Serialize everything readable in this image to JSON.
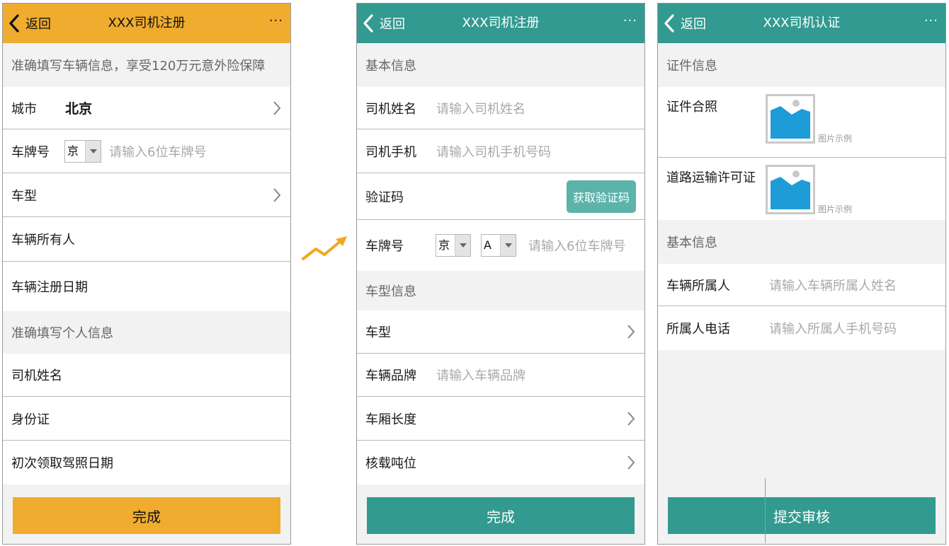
{
  "colors": {
    "orange": "#efac2e",
    "teal": "#329a90",
    "teal_light": "#5bb3aa",
    "section_bg": "#f2f2f2",
    "placeholder": "#a9a9a9",
    "image_blue": "#1e9cd7"
  },
  "icons": {
    "back": "chevron-left-icon",
    "more": "ellipsis-icon",
    "row_arrow": "chevron-right-icon",
    "select_arrow": "caret-down-icon",
    "flow": "trend-arrow-icon",
    "photo": "image-placeholder-icon"
  },
  "screen1": {
    "nav": {
      "back": "返回",
      "title": "XXX司机注册",
      "more": "···"
    },
    "notice": "准确填写车辆信息，享受120万元意外险保障",
    "rows": {
      "city": {
        "label": "城市",
        "value": "北京"
      },
      "plate": {
        "label": "车牌号",
        "province": "京",
        "placeholder": "请输入6位车牌号"
      },
      "model": {
        "label": "车型"
      },
      "owner": {
        "label": "车辆所有人"
      },
      "reg_date": {
        "label": "车辆注册日期"
      }
    },
    "section_personal": "准确填写个人信息",
    "rows2": {
      "name": {
        "label": "司机姓名"
      },
      "id": {
        "label": "身份证"
      },
      "license": {
        "label": "初次领取驾照日期"
      }
    },
    "done": "完成"
  },
  "screen2": {
    "nav": {
      "back": "返回",
      "title": "XXX司机注册",
      "more": "···"
    },
    "section_basic": "基本信息",
    "rows": {
      "name": {
        "label": "司机姓名",
        "placeholder": "请输入司机姓名"
      },
      "phone": {
        "label": "司机手机",
        "placeholder": "请输入司机手机号码"
      },
      "code": {
        "label": "验证码",
        "button": "获取验证码"
      },
      "plate": {
        "label": "车牌号",
        "province": "京",
        "letter": "A",
        "placeholder": "请输入6位车牌号"
      }
    },
    "section_vehicle": "车型信息",
    "rows2": {
      "model": {
        "label": "车型"
      },
      "brand": {
        "label": "车辆品牌",
        "placeholder": "请输入车辆品牌"
      },
      "length": {
        "label": "车厢长度"
      },
      "tonnage": {
        "label": "核载吨位"
      }
    },
    "done": "完成"
  },
  "screen3": {
    "nav": {
      "back": "返回",
      "title": "XXX司机认证",
      "more": "···"
    },
    "section_cert": "证件信息",
    "certs": {
      "group_photo": {
        "label": "证件合照",
        "caption": "图片示例"
      },
      "road_permit": {
        "label": "道路运输许可证",
        "caption": "图片示例"
      }
    },
    "section_basic": "基本信息",
    "rows": {
      "owner": {
        "label": "车辆所属人",
        "placeholder": "请输入车辆所属人姓名"
      },
      "owner_phone": {
        "label": "所属人电话",
        "placeholder": "请输入所属人手机号码"
      }
    },
    "submit": "提交审核"
  }
}
